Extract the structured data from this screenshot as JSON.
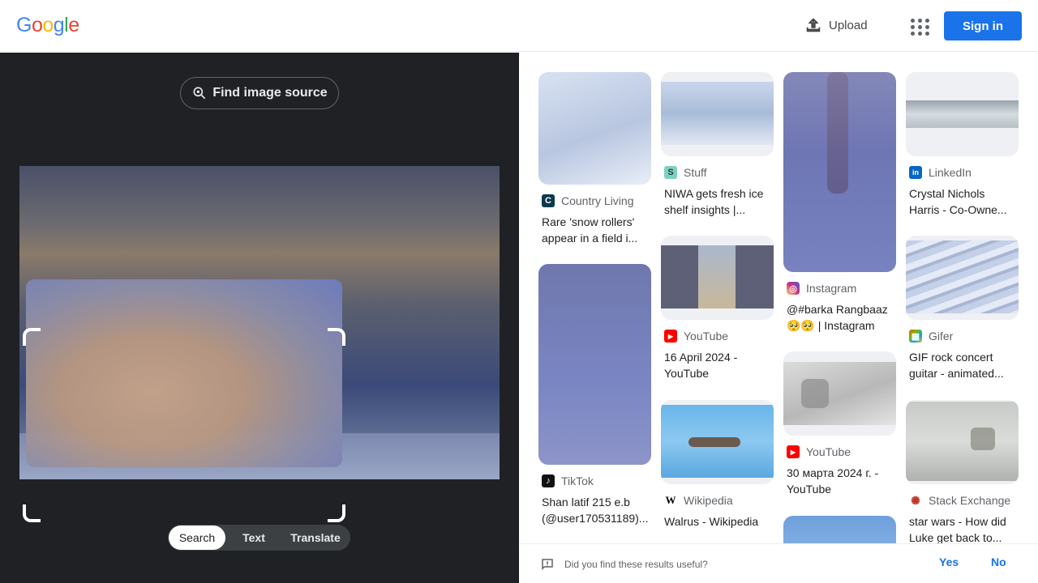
{
  "header": {
    "logo": "Google",
    "upload_label": "Upload",
    "signin_label": "Sign in"
  },
  "left": {
    "find_source_label": "Find image source",
    "modes": [
      "Search",
      "Text",
      "Translate"
    ],
    "active_mode": "Search"
  },
  "results": [
    {
      "source": "Country Living",
      "title": "Rare 'snow rollers' appear in a field i...",
      "fav_color": "#0b3a4a",
      "fav_glyph": "C"
    },
    {
      "source": "TikTok",
      "title": "Shan latif 215 e.b (@user170531189)...",
      "fav_color": "#111111",
      "fav_glyph": "♪"
    },
    {
      "source": "Stuff",
      "title": "NIWA gets fresh ice shelf insights |...",
      "fav_color": "#7fd0c0",
      "fav_glyph": "S"
    },
    {
      "source": "YouTube",
      "title": "16 April 2024 - YouTube",
      "fav_color": "#ff0000",
      "fav_glyph": "▶"
    },
    {
      "source": "Wikipedia",
      "title": "Walrus - Wikipedia",
      "fav_color": "#ffffff",
      "fav_glyph": "W"
    },
    {
      "source": "Instagram",
      "title": "@#barka Rangbaaz 🥺🥺 | Instagram",
      "fav_color": "#d62976",
      "fav_glyph": "◎"
    },
    {
      "source": "YouTube",
      "title": "30 марта 2024 г. - YouTube",
      "fav_color": "#ff0000",
      "fav_glyph": "▶"
    },
    {
      "source": "LinkedIn",
      "title": "Crystal Nichols Harris - Co-Owne...",
      "fav_color": "#0a66c2",
      "fav_glyph": "in"
    },
    {
      "source": "Gifer",
      "title": "GIF rock concert guitar - animated...",
      "fav_color": "#7bc043",
      "fav_glyph": "▦"
    },
    {
      "source": "Stack Exchange",
      "title": "star wars - How did Luke get back to...",
      "fav_color": "#ffffff",
      "fav_glyph": "✺"
    }
  ],
  "feedback": {
    "question": "Did you find these results useful?",
    "yes": "Yes",
    "no": "No"
  },
  "colors": {
    "accent": "#1a73e8",
    "dark_panel": "#202124"
  }
}
